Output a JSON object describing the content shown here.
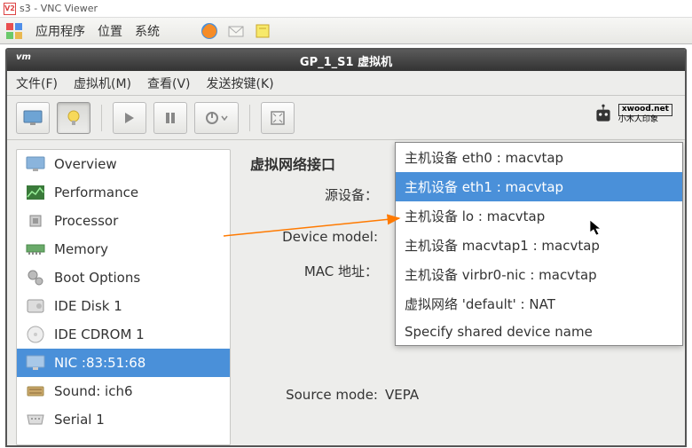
{
  "host": {
    "title": "s3 - VNC Viewer"
  },
  "gnome": {
    "apps": "应用程序",
    "places": "位置",
    "system": "系统"
  },
  "vm": {
    "title": "GP_1_S1 虚拟机",
    "menubar": {
      "file": "文件(F)",
      "vm": "虚拟机(M)",
      "view": "查看(V)",
      "send": "发送按键(K)"
    },
    "brand": {
      "top": "xwood.net",
      "bottom": "小木人印象"
    }
  },
  "sidebar": {
    "items": [
      {
        "icon": "monitor",
        "label": "Overview"
      },
      {
        "icon": "perf",
        "label": "Performance"
      },
      {
        "icon": "cpu",
        "label": "Processor"
      },
      {
        "icon": "memory",
        "label": "Memory"
      },
      {
        "icon": "boot",
        "label": "Boot Options"
      },
      {
        "icon": "disk",
        "label": "IDE Disk 1"
      },
      {
        "icon": "cdrom",
        "label": "IDE CDROM 1"
      },
      {
        "icon": "nic",
        "label": "NIC :83:51:68"
      },
      {
        "icon": "sound",
        "label": "Sound: ich6"
      },
      {
        "icon": "serial",
        "label": "Serial 1"
      }
    ]
  },
  "detail": {
    "section": "虚拟网络接口",
    "rows": {
      "source_device": "源设备：",
      "device_model": "Device model:",
      "mac": "MAC 地址：",
      "source_mode": "Source mode:",
      "source_mode_value": "VEPA"
    }
  },
  "dropdown": {
    "options": [
      "主机设备 eth0 : macvtap",
      "主机设备 eth1 : macvtap",
      "主机设备 lo : macvtap",
      "主机设备 macvtap1 : macvtap",
      "主机设备 virbr0-nic : macvtap",
      "虚拟网络 'default' : NAT",
      "Specify shared device name"
    ]
  }
}
